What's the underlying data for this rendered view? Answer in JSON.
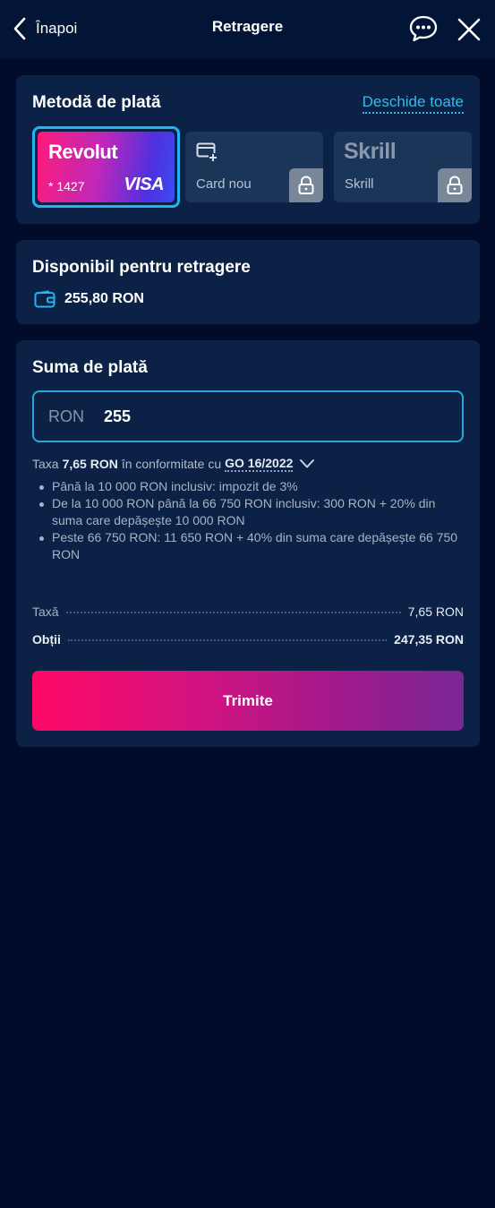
{
  "header": {
    "back_label": "Înapoi",
    "title": "Retragere"
  },
  "payment_method": {
    "title": "Metodă de plată",
    "open_all_label": "Deschide toate",
    "methods": [
      {
        "brand": "Revolut",
        "number": "* 1427",
        "network": "VISA",
        "selected": true
      },
      {
        "label": "Card nou",
        "icon": "add-card-icon",
        "locked": true
      },
      {
        "brand": "Skrill",
        "label": "Skrill",
        "icon": "lock-icon",
        "locked": true
      }
    ]
  },
  "available": {
    "title": "Disponibil pentru retragere",
    "amount": "255,80 RON"
  },
  "payment_sum": {
    "title": "Suma de plată",
    "currency": "RON",
    "amount_value": "255",
    "tax_prefix": "Taxa",
    "tax_amount": "7,65 RON",
    "tax_middle": "în conformitate cu",
    "tax_law": "GO 16/2022",
    "tax_rules": [
      "Până la 10 000 RON inclusiv: impozit de 3%",
      "De la 10 000 RON până la 66 750 RON inclusiv: 300 RON + 20% din suma care depășește 10 000 RON",
      "Peste 66 750 RON: 11 650 RON + 40% din suma care depășește 66 750 RON"
    ],
    "fee_label": "Taxă",
    "fee_value": "7,65 RON",
    "total_label": "Obții",
    "total_value": "247,35 RON",
    "submit_label": "Trimite"
  },
  "colors": {
    "background": "#010c2a",
    "card": "#0b2246",
    "accent": "#23b4ef",
    "button_start": "#ff0866",
    "button_end": "#7a2796"
  }
}
